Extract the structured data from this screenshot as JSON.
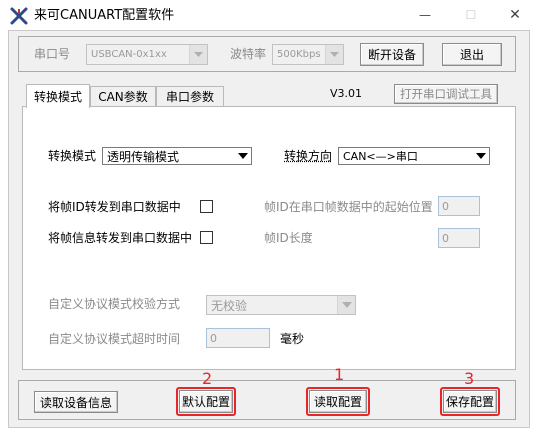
{
  "window": {
    "title": "来可CANUART配置软件",
    "controls": {
      "minimize": "—",
      "maximize": "☐",
      "close": "✕"
    }
  },
  "top_bar": {
    "serial_label": "串口号",
    "serial_value": "USBCAN-0x1xx",
    "baud_label": "波特率",
    "baud_value": "500Kbps",
    "disconnect_button": "断开设备",
    "exit_button": "退出"
  },
  "tabs": [
    {
      "label": "转换模式",
      "active": true
    },
    {
      "label": "CAN参数",
      "active": false
    },
    {
      "label": "串口参数",
      "active": false
    }
  ],
  "version": "V3.01",
  "open_debug_tool_button": "打开串口调试工具",
  "conversion": {
    "mode_label": "转换模式",
    "mode_value": "透明传输模式",
    "direction_label": "转换方向",
    "direction_value": "CAN<—>串口",
    "forward_frame_id_label": "将帧ID转发到串口数据中",
    "forward_frame_info_label": "将帧信息转发到串口数据中",
    "frame_id_start_pos_label": "帧ID在串口帧数据中的起始位置",
    "frame_id_start_pos_value": "0",
    "frame_id_length_label": "帧ID长度",
    "frame_id_length_value": "0",
    "custom_checksum_label": "自定义协议模式校验方式",
    "custom_checksum_value": "无校验",
    "custom_timeout_label": "自定义协议模式超时时间",
    "custom_timeout_value": "0",
    "custom_timeout_unit": "毫秒"
  },
  "bottom_bar": {
    "read_device_info_button": "读取设备信息",
    "default_config_button": "默认配置",
    "read_config_button": "读取配置",
    "save_config_button": "保存配置"
  },
  "annotations": {
    "marker_1": "1",
    "marker_2": "2",
    "marker_3": "3",
    "color": "#e8262a"
  }
}
